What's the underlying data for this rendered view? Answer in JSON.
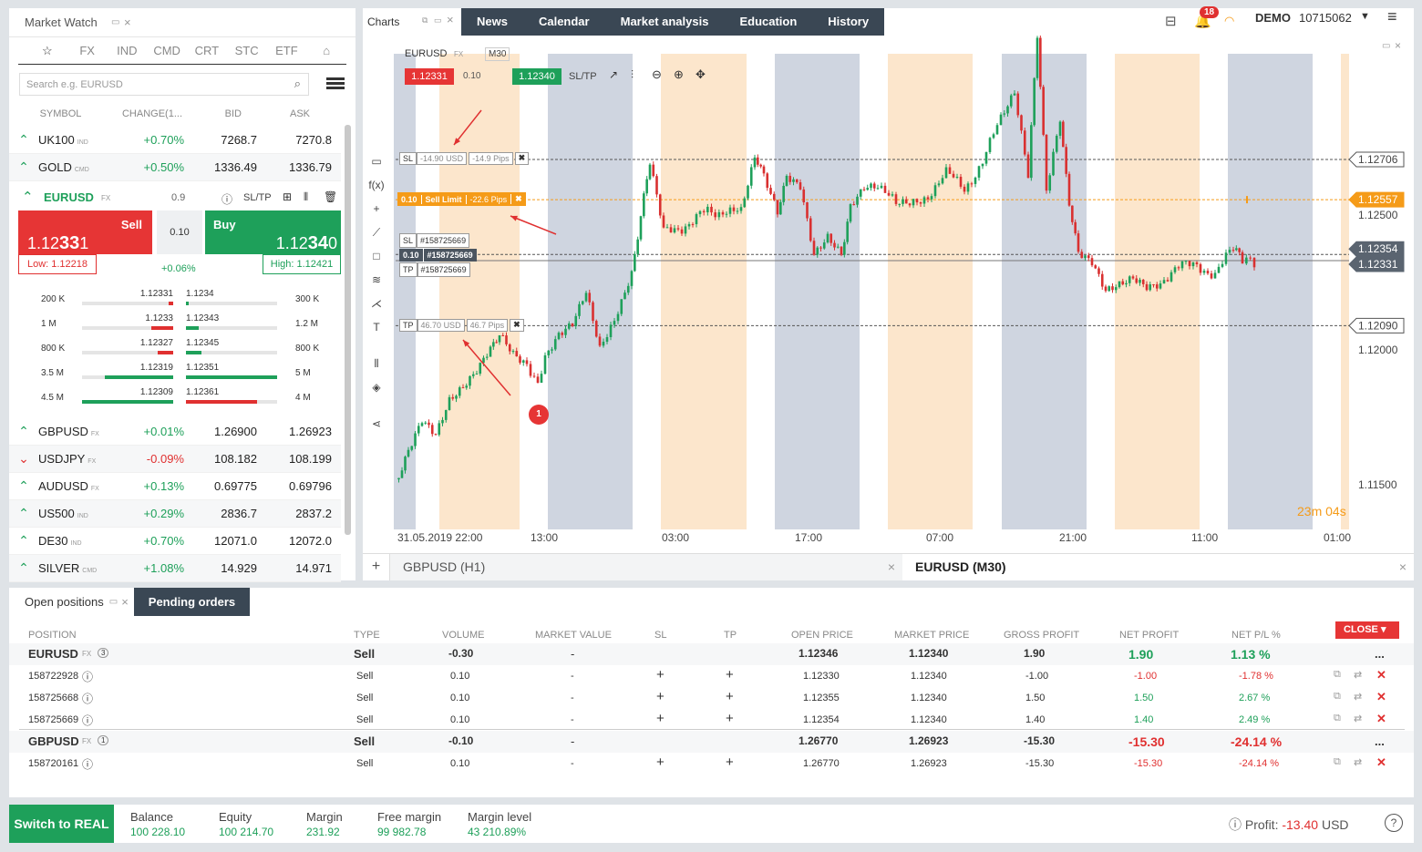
{
  "market_watch": {
    "title": "Market Watch",
    "tabs": [
      "FX",
      "IND",
      "CMD",
      "CRT",
      "STC",
      "ETF"
    ],
    "search_placeholder": "Search e.g. EURUSD",
    "columns": [
      "SYMBOL",
      "CHANGE(1...",
      "BID",
      "ASK"
    ],
    "top_rows": [
      {
        "symbol": "UK100",
        "type": "IND",
        "change": "+0.70%",
        "bid": "7268.7",
        "ask": "7270.8",
        "dir": "up"
      },
      {
        "symbol": "GOLD",
        "type": "CMD",
        "change": "+0.50%",
        "bid": "1336.49",
        "ask": "1336.79",
        "dir": "up"
      }
    ],
    "selected": {
      "symbol": "EURUSD",
      "type": "FX",
      "spread": "0.9",
      "sltp": "SL/TP",
      "sell_label": "Sell",
      "sell_price_a": "1.12",
      "sell_price_b": "33",
      "sell_price_c": "1",
      "buy_label": "Buy",
      "buy_price_a": "1.12",
      "buy_price_b": "34",
      "buy_price_c": "0",
      "volume": "0.10",
      "low": "Low: 1.12218",
      "high": "High: 1.12421",
      "change": "+0.06%"
    },
    "depth": [
      {
        "lv": "200 K",
        "bid": "1.12331",
        "ask": "1.1234",
        "rv": "300 K",
        "bw": 5,
        "aw": 3
      },
      {
        "lv": "1 M",
        "bid": "1.1233",
        "ask": "1.12343",
        "rv": "1.2 M",
        "bw": 24,
        "aw": 14
      },
      {
        "lv": "800 K",
        "bid": "1.12327",
        "ask": "1.12345",
        "rv": "800 K",
        "bw": 17,
        "aw": 17
      },
      {
        "lv": "3.5 M",
        "bid": "1.12319",
        "ask": "1.12351",
        "rv": "5 M",
        "bw": 75,
        "aw": 100
      },
      {
        "lv": "4.5 M",
        "bid": "1.12309",
        "ask": "1.12361",
        "rv": "4 M",
        "bw": 100,
        "aw": 78
      }
    ],
    "rows": [
      {
        "symbol": "GBPUSD",
        "type": "FX",
        "change": "+0.01%",
        "bid": "1.26900",
        "ask": "1.26923",
        "dir": "up"
      },
      {
        "symbol": "USDJPY",
        "type": "FX",
        "change": "-0.09%",
        "bid": "108.182",
        "ask": "108.199",
        "dir": "dn"
      },
      {
        "symbol": "AUDUSD",
        "type": "FX",
        "change": "+0.13%",
        "bid": "0.69775",
        "ask": "0.69796",
        "dir": "up"
      },
      {
        "symbol": "US500",
        "type": "IND",
        "change": "+0.29%",
        "bid": "2836.7",
        "ask": "2837.2",
        "dir": "up"
      },
      {
        "symbol": "DE30",
        "type": "IND",
        "change": "+0.70%",
        "bid": "12071.0",
        "ask": "12072.0",
        "dir": "up"
      },
      {
        "symbol": "SILVER",
        "type": "CMD",
        "change": "+1.08%",
        "bid": "14.929",
        "ask": "14.971",
        "dir": "up"
      }
    ]
  },
  "top_nav": {
    "charts_label": "Charts",
    "tabs": [
      "News",
      "Calendar",
      "Market analysis",
      "Education",
      "History"
    ],
    "notifications": "18",
    "account_mode": "DEMO",
    "account_no": "10715062"
  },
  "chart": {
    "symbol": "EURUSD",
    "type": "FX",
    "timeframe": "M30",
    "sell_price": "1.12331",
    "volume": "0.10",
    "buy_price": "1.12340",
    "sltp": "SL/TP",
    "price_labels": [
      "1.12706",
      "1.12557",
      "1.12500",
      "1.12354",
      "1.12331",
      "1.12090",
      "1.12000",
      "1.11500"
    ],
    "time_labels": [
      "31.05.2019 22:00",
      "13:00",
      "03:00",
      "17:00",
      "07:00",
      "21:00",
      "11:00",
      "01:00"
    ],
    "countdown": "23m 04s",
    "sl_line": {
      "tag": "SL",
      "usd": "-14.90",
      "usd_unit": "USD",
      "pips": "-14.9",
      "pips_unit": "Pips"
    },
    "limit_line": {
      "vol": "0.10",
      "label": "Sell Limit",
      "pips": "-22.6",
      "pips_unit": "Pips"
    },
    "pos_line": {
      "sl_id": "#158725669",
      "vol": "0.10",
      "id": "#158725669",
      "tp_id": "#158725669",
      "sl": "SL",
      "tp": "TP"
    },
    "tp_line": {
      "tag": "TP",
      "usd": "46.70",
      "usd_unit": "USD",
      "pips": "46.7",
      "pips_unit": "Pips"
    },
    "marker": "1",
    "bottom_tabs": [
      "GBPUSD (H1)",
      "EURUSD (M30)"
    ]
  },
  "positions": {
    "tab_open": "Open positions",
    "tab_pending": "Pending orders",
    "headers": [
      "POSITION",
      "TYPE",
      "VOLUME",
      "MARKET VALUE",
      "SL",
      "TP",
      "OPEN PRICE",
      "MARKET PRICE",
      "GROSS PROFIT",
      "NET PROFIT",
      "NET P/L %"
    ],
    "close_label": "CLOSE",
    "groups": [
      {
        "symbol": "EURUSD",
        "type": "FX",
        "count": "3",
        "side": "Sell",
        "volume": "-0.30",
        "mv": "-",
        "open": "1.12346",
        "market": "1.12340",
        "gross": "1.90",
        "net": "1.90",
        "netpl": "1.13 %",
        "pos": true,
        "rows": [
          {
            "id": "158722928",
            "side": "Sell",
            "volume": "0.10",
            "mv": "-",
            "open": "1.12330",
            "market": "1.12340",
            "gross": "-1.00",
            "net": "-1.00",
            "netpl": "-1.78 %",
            "pos": false
          },
          {
            "id": "158725668",
            "side": "Sell",
            "volume": "0.10",
            "mv": "-",
            "open": "1.12355",
            "market": "1.12340",
            "gross": "1.50",
            "net": "1.50",
            "netpl": "2.67 %",
            "pos": true
          },
          {
            "id": "158725669",
            "side": "Sell",
            "volume": "0.10",
            "mv": "-",
            "open": "1.12354",
            "market": "1.12340",
            "gross": "1.40",
            "net": "1.40",
            "netpl": "2.49 %",
            "pos": true
          }
        ]
      },
      {
        "symbol": "GBPUSD",
        "type": "FX",
        "count": "1",
        "side": "Sell",
        "volume": "-0.10",
        "mv": "-",
        "open": "1.26770",
        "market": "1.26923",
        "gross": "-15.30",
        "net": "-15.30",
        "netpl": "-24.14 %",
        "pos": false,
        "rows": [
          {
            "id": "158720161",
            "side": "Sell",
            "volume": "0.10",
            "mv": "-",
            "open": "1.26770",
            "market": "1.26923",
            "gross": "-15.30",
            "net": "-15.30",
            "netpl": "-24.14 %",
            "pos": false
          }
        ]
      }
    ]
  },
  "footer": {
    "switch_label": "Switch to REAL",
    "balance_label": "Balance",
    "balance": "100 228.10",
    "equity_label": "Equity",
    "equity": "100 214.70",
    "margin_label": "Margin",
    "margin": "231.92",
    "free_margin_label": "Free margin",
    "free_margin": "99 982.78",
    "margin_level_label": "Margin level",
    "margin_level": "43 210.89%",
    "profit_label": "Profit:",
    "profit": "-13.40",
    "profit_ccy": "USD"
  },
  "colors": {
    "buy": "#1ea05a",
    "sell": "#e03030",
    "nav": "#3a4754",
    "accent": "#f59b18"
  }
}
